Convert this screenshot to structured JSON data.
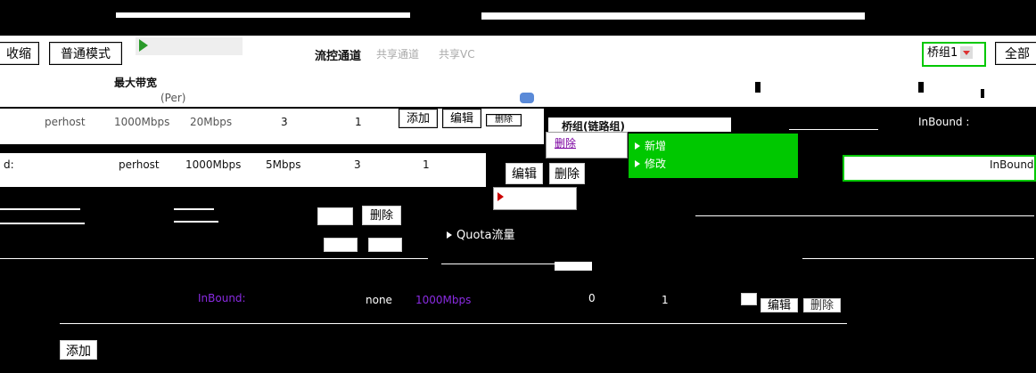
{
  "toolbar": {
    "collapse_label": "收缩",
    "normal_mode_label": "普通模式",
    "add_label": "添加"
  },
  "tabs": {
    "flow_channel": "流控通道",
    "shared_channel": "共享通道",
    "shared_vc": "共享VC"
  },
  "header": {
    "max_bandwidth_label": "最大带宽",
    "per_unit": "(Per)"
  },
  "bridge_select": {
    "value": "桥组1",
    "all_label": "全部"
  },
  "rows": [
    {
      "type": "perhost",
      "max_bw": "1000Mbps",
      "min_bw": "20Mbps",
      "prio": "3",
      "flag": "1"
    },
    {
      "type": "perhost",
      "max_bw": "1000Mbps",
      "min_bw": "5Mbps",
      "prio": "3",
      "flag": "1"
    }
  ],
  "row_actions": {
    "add": "添加",
    "edit": "编辑",
    "delete": "删除"
  },
  "context_menu": {
    "title": "桥组(链路组)",
    "items": [
      "删除",
      "新增",
      "修改",
      "Quota流量"
    ],
    "quota_item": "Quota流量"
  },
  "right_panel": {
    "inbound_1": "InBound :",
    "inbound_2": "InBound"
  },
  "bottom_row": {
    "inbound": "InBound:",
    "type": "none",
    "bw": "1000Mbps",
    "val_a": "0",
    "val_b": "1",
    "edit": "编辑",
    "delete": "删除"
  },
  "labels": {
    "d_label": "d:"
  }
}
